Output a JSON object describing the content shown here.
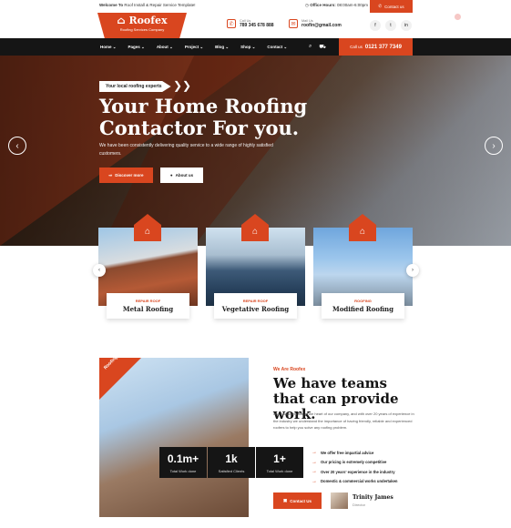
{
  "topbar": {
    "welcome_strong": "Welcome To",
    "welcome_text": " Roof Install & Repair Service Template!",
    "hours_strong": "Office Hours:",
    "hours_text": " 08:00am-6:00pm",
    "contact_label": "Contact us"
  },
  "logo": {
    "name": "Roofex",
    "tagline": "Roofing Services Company"
  },
  "header": {
    "call_label": "Call Us",
    "call_value": "789 345 678 888",
    "mail_label": "Mail Us",
    "mail_value": "roofin@gmail.com",
    "socials": [
      "f",
      "t",
      "in"
    ]
  },
  "nav": {
    "items": [
      "Home ⌄",
      "Pages ⌄",
      "About ⌄",
      "Project ⌄",
      "Blog ⌄",
      "Shop ⌄",
      "Contact ⌄"
    ],
    "call_small": "Call us",
    "call_number": "0121 377 7349"
  },
  "hero": {
    "badge": "Your local roofing experts",
    "title": "Your Home Roofing Contactor For you.",
    "description": "We have been consistently delivering quality service to a wide range of highly satisfied customers.",
    "btn_primary": "Discover more",
    "btn_secondary": "About us"
  },
  "services": [
    {
      "category": "REPAIR ROOF",
      "name": "Metal Roofing"
    },
    {
      "category": "REPAIR ROOF",
      "name": "Vegetative Roofing"
    },
    {
      "category": "ROOFING",
      "name": "Modified Roofing"
    }
  ],
  "about": {
    "ribbon": "Roofing Experts",
    "kicker": "We Are Roofex",
    "title": "We have teams that can provide work.",
    "description": "Our customers are at the heart of our company, and with over 20 years of experience in the industry we understand the importance of having friendly, reliable and experienced roofers to help you solve any roofing problem.",
    "bullets": [
      "We offer free impartial advice",
      "Our pricing is extremely competitive",
      "Over 20 years' experience in the industry",
      "Domestic & commercial works undertaken"
    ],
    "stats": [
      {
        "value": "0.1m+",
        "label": "Total Work done"
      },
      {
        "value": "1k",
        "label": "Satisfied Clients"
      },
      {
        "value": "1+",
        "label": "Total Work done"
      }
    ],
    "contact_btn": "Contact Us",
    "person_name": "Trinity James",
    "person_role": "Director"
  },
  "colors": {
    "accent": "#d9461f",
    "dark": "#151515"
  }
}
